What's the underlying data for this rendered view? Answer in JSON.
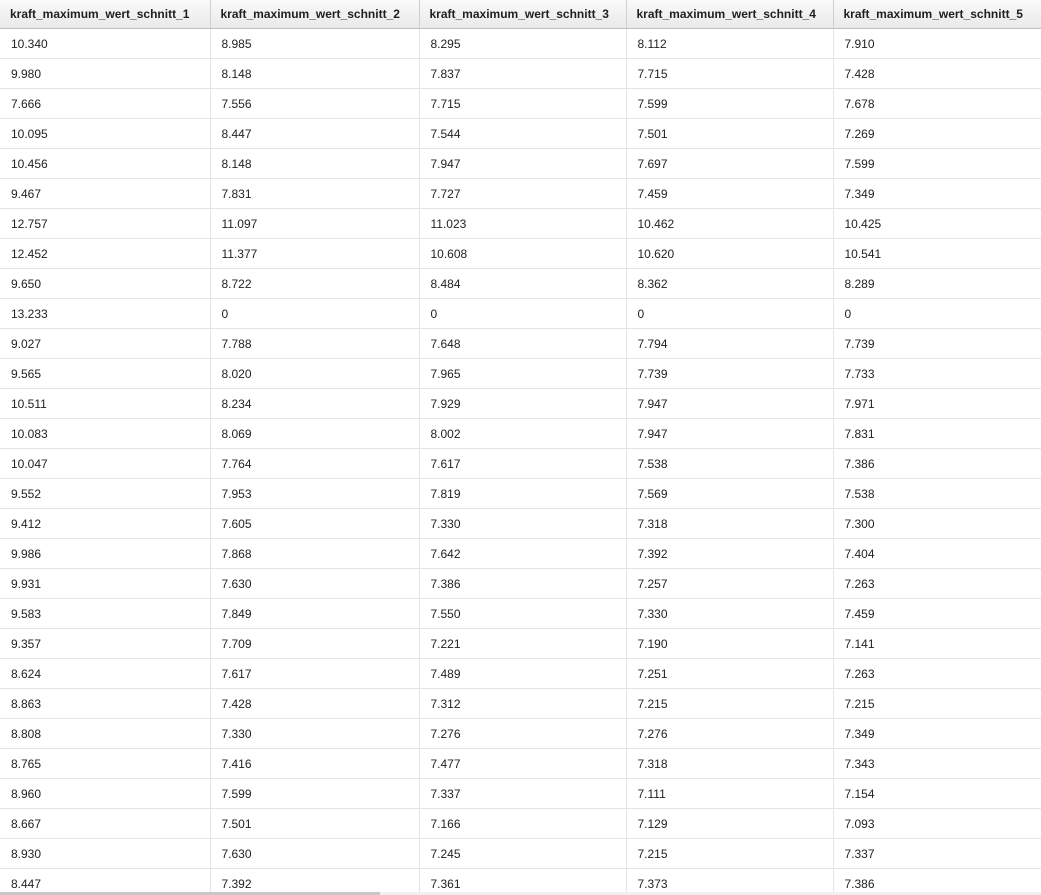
{
  "table": {
    "columns": [
      "kraft_maximum_wert_schnitt_1",
      "kraft_maximum_wert_schnitt_2",
      "kraft_maximum_wert_schnitt_3",
      "kraft_maximum_wert_schnitt_4",
      "kraft_maximum_wert_schnitt_5"
    ],
    "rows": [
      [
        "10.340",
        "8.985",
        "8.295",
        "8.112",
        "7.910"
      ],
      [
        "9.980",
        "8.148",
        "7.837",
        "7.715",
        "7.428"
      ],
      [
        "7.666",
        "7.556",
        "7.715",
        "7.599",
        "7.678"
      ],
      [
        "10.095",
        "8.447",
        "7.544",
        "7.501",
        "7.269"
      ],
      [
        "10.456",
        "8.148",
        "7.947",
        "7.697",
        "7.599"
      ],
      [
        "9.467",
        "7.831",
        "7.727",
        "7.459",
        "7.349"
      ],
      [
        "12.757",
        "11.097",
        "11.023",
        "10.462",
        "10.425"
      ],
      [
        "12.452",
        "11.377",
        "10.608",
        "10.620",
        "10.541"
      ],
      [
        "9.650",
        "8.722",
        "8.484",
        "8.362",
        "8.289"
      ],
      [
        "13.233",
        "0",
        "0",
        "0",
        "0"
      ],
      [
        "9.027",
        "7.788",
        "7.648",
        "7.794",
        "7.739"
      ],
      [
        "9.565",
        "8.020",
        "7.965",
        "7.739",
        "7.733"
      ],
      [
        "10.511",
        "8.234",
        "7.929",
        "7.947",
        "7.971"
      ],
      [
        "10.083",
        "8.069",
        "8.002",
        "7.947",
        "7.831"
      ],
      [
        "10.047",
        "7.764",
        "7.617",
        "7.538",
        "7.386"
      ],
      [
        "9.552",
        "7.953",
        "7.819",
        "7.569",
        "7.538"
      ],
      [
        "9.412",
        "7.605",
        "7.330",
        "7.318",
        "7.300"
      ],
      [
        "9.986",
        "7.868",
        "7.642",
        "7.392",
        "7.404"
      ],
      [
        "9.931",
        "7.630",
        "7.386",
        "7.257",
        "7.263"
      ],
      [
        "9.583",
        "7.849",
        "7.550",
        "7.330",
        "7.459"
      ],
      [
        "9.357",
        "7.709",
        "7.221",
        "7.190",
        "7.141"
      ],
      [
        "8.624",
        "7.617",
        "7.489",
        "7.251",
        "7.263"
      ],
      [
        "8.863",
        "7.428",
        "7.312",
        "7.215",
        "7.215"
      ],
      [
        "8.808",
        "7.330",
        "7.276",
        "7.276",
        "7.349"
      ],
      [
        "8.765",
        "7.416",
        "7.477",
        "7.318",
        "7.343"
      ],
      [
        "8.960",
        "7.599",
        "7.337",
        "7.111",
        "7.154"
      ],
      [
        "8.667",
        "7.501",
        "7.166",
        "7.129",
        "7.093"
      ],
      [
        "8.930",
        "7.630",
        "7.245",
        "7.215",
        "7.337"
      ],
      [
        "8.447",
        "7.392",
        "7.361",
        "7.373",
        "7.386"
      ]
    ]
  },
  "colors": {
    "header_bg": "#eeeeee",
    "grid_line": "#e4e4e4",
    "text": "#222222"
  }
}
